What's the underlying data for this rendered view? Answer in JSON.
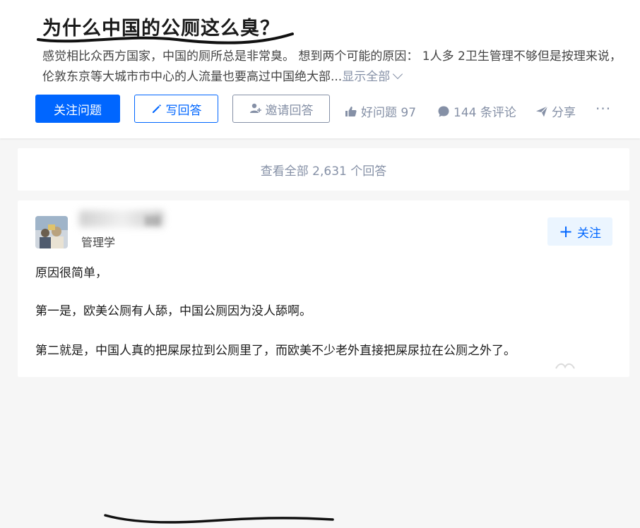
{
  "question": {
    "title": "为什么中国的公厕这么臭？",
    "excerpt": "感觉相比众西方国家，中国的厕所总是非常臭。 想到两个可能的原因： 1人多 2卫生管理不够但是按理来说，伦敦东京等大城市市中心的人流量也要高过中国绝大部...",
    "show_all_label": "显示全部",
    "actions": {
      "follow_label": "关注问题",
      "write_answer_label": "写回答",
      "invite_label": "邀请回答",
      "upvote_label": "好问题 97",
      "comments_label": "144 条评论",
      "share_label": "分享",
      "more_label": "···"
    }
  },
  "view_all_answers_label": "查看全部 2,631 个回答",
  "answer": {
    "author_headline": "管理学",
    "follow_label": "关注",
    "paragraphs": [
      "原因很简单，",
      "第一是，欧美公厕有人舔，中国公厕因为没人舔啊。",
      "第二就是，中国人真的把屎尿拉到公厕里了，而欧美不少老外直接把屎尿拉在公厕之外了。"
    ]
  },
  "colors": {
    "brand_blue": "#0066ff",
    "muted_gray": "#8590a6",
    "page_bg": "#f6f6f6"
  },
  "icons": [
    "pencil-icon",
    "invite-user-icon",
    "thumbs-up-icon",
    "comment-icon",
    "share-icon",
    "plus-icon"
  ]
}
